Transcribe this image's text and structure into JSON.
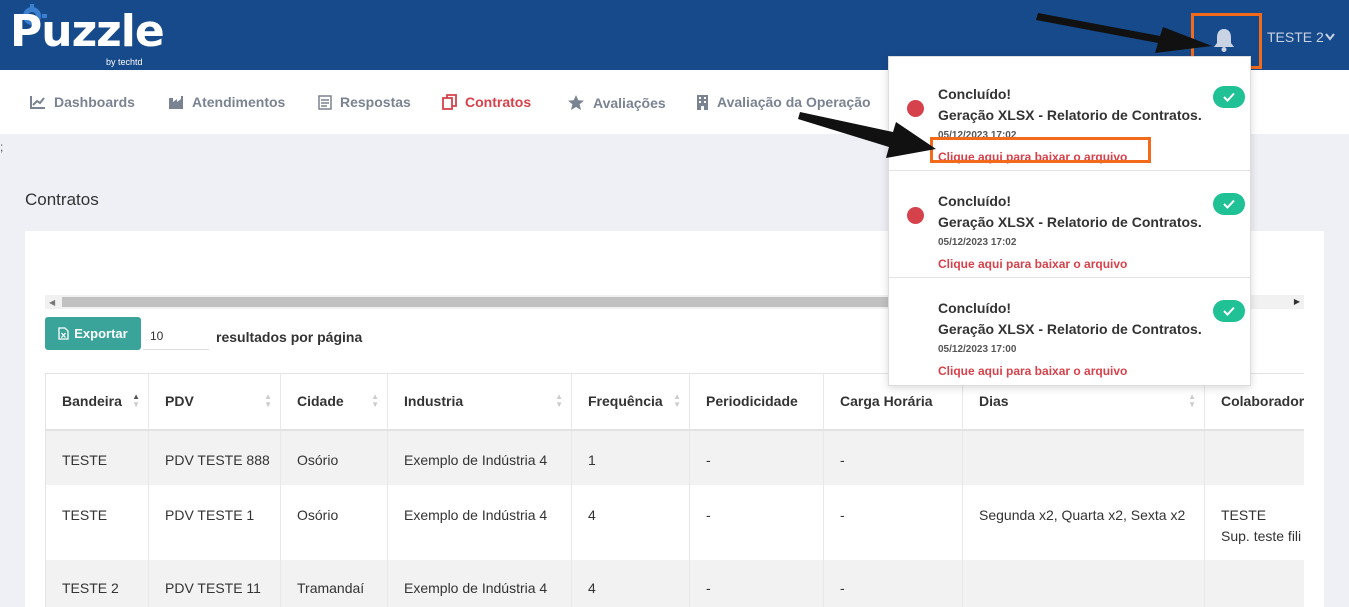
{
  "header": {
    "logo_text": "Puzzle",
    "logo_sub": "by techtd",
    "user_name": "TESTE 2",
    "bell_icon": "bell-icon"
  },
  "nav": {
    "items": [
      {
        "label": "Dashboards",
        "icon": "chart-icon"
      },
      {
        "label": "Atendimentos",
        "icon": "factory-icon"
      },
      {
        "label": "Respostas",
        "icon": "form-icon"
      },
      {
        "label": "Contratos",
        "icon": "copy-icon",
        "active": true
      },
      {
        "label": "Avaliações",
        "icon": "star-icon"
      },
      {
        "label": "Avaliação da Operação",
        "icon": "building-icon"
      }
    ],
    "active_color": "#d6424b"
  },
  "stray_text": ";",
  "page": {
    "title": "Contratos",
    "export_label": "Exportar",
    "per_page_value": "10",
    "per_page_label": "resultados por página"
  },
  "table": {
    "columns": [
      "Bandeira",
      "PDV",
      "Cidade",
      "Industria",
      "Frequência",
      "Periodicidade",
      "Carga Horária",
      "Dias",
      "Colaborador"
    ],
    "rows": [
      [
        "TESTE",
        "PDV TESTE 888",
        "Osório",
        "Exemplo de Indústria 4",
        "1",
        "-",
        "-",
        "",
        ""
      ],
      [
        "TESTE",
        "PDV TESTE 1",
        "Osório",
        "Exemplo de Indústria 4",
        "4",
        "-",
        "-",
        "Segunda x2, Quarta x2, Sexta x2",
        "TESTE",
        "Sup. teste fili"
      ],
      [
        "TESTE 2",
        "PDV TESTE 11",
        "Tramandaí",
        "Exemplo de Indústria 4",
        "4",
        "-",
        "-",
        "",
        ""
      ]
    ]
  },
  "notifications": [
    {
      "title": "Concluído!",
      "message": "Geração XLSX - Relatorio de Contratos.",
      "date": "05/12/2023 17:02",
      "link": "Clique aqui para baixar o arquivo"
    },
    {
      "title": "Concluído!",
      "message": "Geração XLSX - Relatorio de Contratos.",
      "date": "05/12/2023 17:02",
      "link": "Clique aqui para baixar o arquivo"
    },
    {
      "title": "Concluído!",
      "message": "Geração XLSX - Relatorio de Contratos.",
      "date": "05/12/2023 17:00",
      "link": "Clique aqui para baixar o arquivo"
    }
  ],
  "colors": {
    "header_bg": "#174a8b",
    "highlight": "#f36a1b",
    "success": "#1fc195",
    "export_bg": "#3aa49a"
  }
}
